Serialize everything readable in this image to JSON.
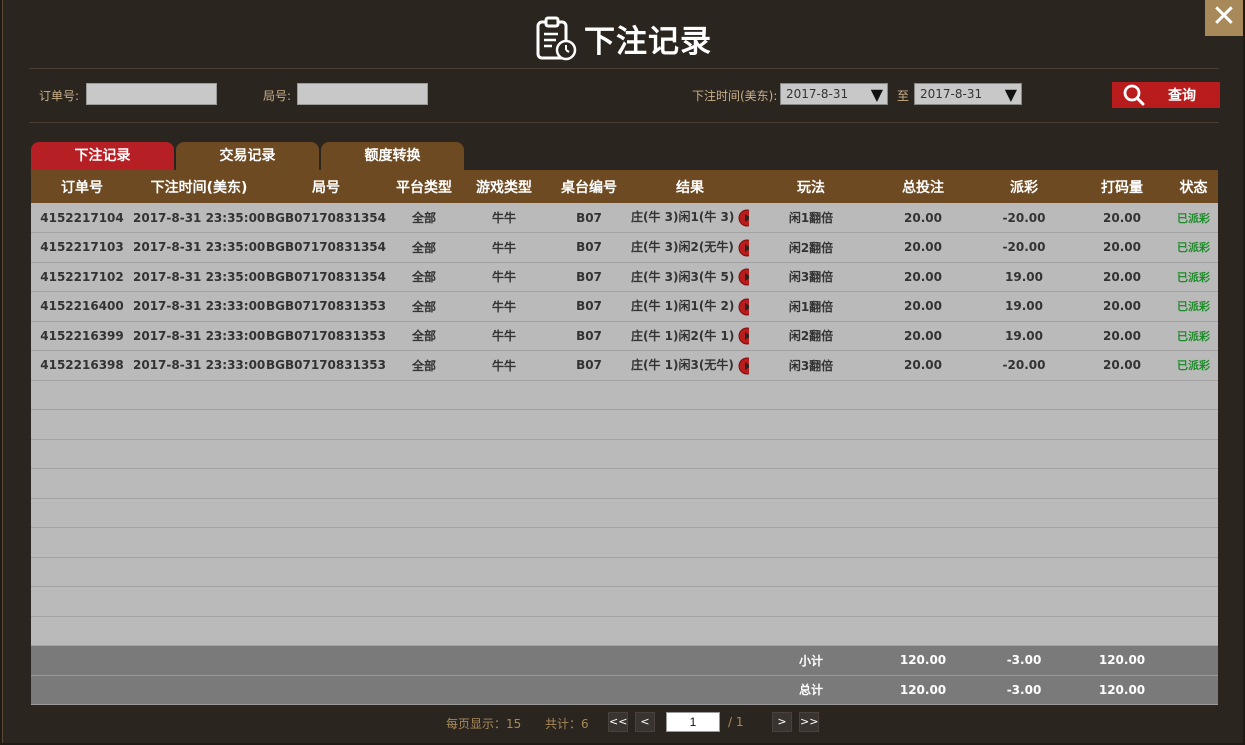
{
  "header": {
    "title": "下注记录",
    "close_label": "✕"
  },
  "filters": {
    "order_label": "订单号:",
    "round_label": "局号:",
    "time_label": "下注时间(美东):",
    "date_from": "2017-8-31",
    "to_label": "至",
    "date_to": "2017-8-31",
    "query_label": "查询"
  },
  "tabs": [
    {
      "label": "下注记录",
      "active": true
    },
    {
      "label": "交易记录",
      "active": false
    },
    {
      "label": "额度转换",
      "active": false
    }
  ],
  "table": {
    "columns": [
      "订单号",
      "下注时间(美东)",
      "局号",
      "平台类型",
      "游戏类型",
      "桌台编号",
      "结果",
      "玩法",
      "总投注",
      "派彩",
      "打码量",
      "状态"
    ],
    "rows": [
      [
        "4152217104",
        "2017-8-31 23:35:00",
        "BGB07170831354",
        "全部",
        "牛牛",
        "B07",
        "庄(牛 3)闲1(牛 3)",
        "闲1翻倍",
        "20.00",
        "-20.00",
        "20.00",
        "已派彩"
      ],
      [
        "4152217103",
        "2017-8-31 23:35:00",
        "BGB07170831354",
        "全部",
        "牛牛",
        "B07",
        "庄(牛 3)闲2(无牛)",
        "闲2翻倍",
        "20.00",
        "-20.00",
        "20.00",
        "已派彩"
      ],
      [
        "4152217102",
        "2017-8-31 23:35:00",
        "BGB07170831354",
        "全部",
        "牛牛",
        "B07",
        "庄(牛 3)闲3(牛 5)",
        "闲3翻倍",
        "20.00",
        "19.00",
        "20.00",
        "已派彩"
      ],
      [
        "4152216400",
        "2017-8-31 23:33:00",
        "BGB07170831353",
        "全部",
        "牛牛",
        "B07",
        "庄(牛 1)闲1(牛 2)",
        "闲1翻倍",
        "20.00",
        "19.00",
        "20.00",
        "已派彩"
      ],
      [
        "4152216399",
        "2017-8-31 23:33:00",
        "BGB07170831353",
        "全部",
        "牛牛",
        "B07",
        "庄(牛 1)闲2(牛 1)",
        "闲2翻倍",
        "20.00",
        "19.00",
        "20.00",
        "已派彩"
      ],
      [
        "4152216398",
        "2017-8-31 23:33:00",
        "BGB07170831353",
        "全部",
        "牛牛",
        "B07",
        "庄(牛 1)闲3(无牛)",
        "闲3翻倍",
        "20.00",
        "-20.00",
        "20.00",
        "已派彩"
      ]
    ],
    "empty_rows": 9,
    "subtotal": {
      "label": "小计",
      "total_bet": "120.00",
      "payout": "-3.00",
      "turnover": "120.00"
    },
    "total": {
      "label": "总计",
      "total_bet": "120.00",
      "payout": "-3.00",
      "turnover": "120.00"
    }
  },
  "pagination": {
    "per_page_text": "每页显示：15",
    "total_text": "共计：6",
    "first_label": "<<",
    "prev_label": "<",
    "current_page": "1",
    "pages_text": "/ 1",
    "next_label": ">",
    "last_label": ">>"
  },
  "colors": {
    "accent_red": "#b91c1c",
    "header_brown": "#6e4a22",
    "status_green": "#1e8c2a",
    "label_gold": "#c8b08a"
  },
  "icons": [
    "clipboard-clock-icon",
    "close-icon",
    "search-icon",
    "play-icon"
  ]
}
